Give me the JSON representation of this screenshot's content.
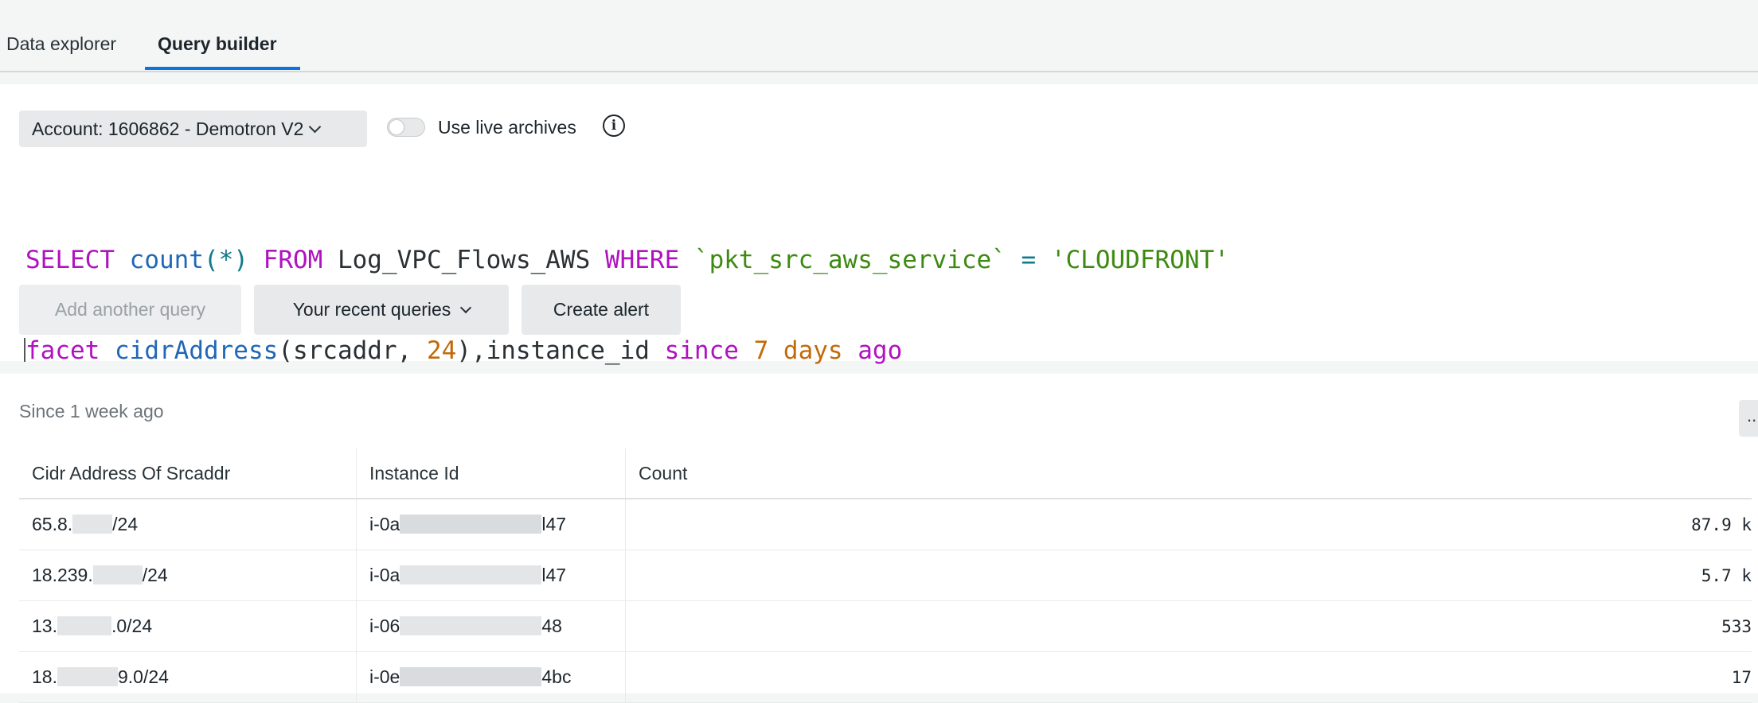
{
  "tabs": [
    {
      "label": "Data explorer",
      "active": false
    },
    {
      "label": "Query builder",
      "active": true
    }
  ],
  "query_panel": {
    "account_label": "Account: 1606862 - Demotron V2",
    "live_archives_label": "Use live archives",
    "live_archives_enabled": false,
    "query_line1": [
      {
        "t": "SELECT",
        "c": "kw"
      },
      {
        "t": " ",
        "c": "tx"
      },
      {
        "t": "count",
        "c": "fn"
      },
      {
        "t": "(*)",
        "c": "op"
      },
      {
        "t": " ",
        "c": "tx"
      },
      {
        "t": "FROM",
        "c": "kw"
      },
      {
        "t": " Log_VPC_Flows_AWS ",
        "c": "tx"
      },
      {
        "t": "WHERE",
        "c": "kw"
      },
      {
        "t": " ",
        "c": "tx"
      },
      {
        "t": "`pkt_src_aws_service`",
        "c": "str"
      },
      {
        "t": " = ",
        "c": "op"
      },
      {
        "t": "'CLOUDFRONT'",
        "c": "str"
      }
    ],
    "query_line2": [
      {
        "t": "facet",
        "c": "kw"
      },
      {
        "t": " ",
        "c": "tx"
      },
      {
        "t": "cidrAddress",
        "c": "fn"
      },
      {
        "t": "(srcaddr, ",
        "c": "tx"
      },
      {
        "t": "24",
        "c": "num"
      },
      {
        "t": "),instance_id ",
        "c": "tx"
      },
      {
        "t": "since",
        "c": "kw"
      },
      {
        "t": " ",
        "c": "tx"
      },
      {
        "t": "7",
        "c": "num"
      },
      {
        "t": " ",
        "c": "tx"
      },
      {
        "t": "days",
        "c": "num"
      },
      {
        "t": " ",
        "c": "tx"
      },
      {
        "t": "ago",
        "c": "kw"
      }
    ],
    "buttons": {
      "add_query": "Add another query",
      "recent_queries": "Your recent queries",
      "create_alert": "Create alert"
    }
  },
  "results": {
    "since_label": "Since 1 week ago",
    "more_label": "...",
    "columns": [
      "Cidr Address Of Srcaddr",
      "Instance Id",
      "Count"
    ],
    "rows": [
      {
        "cidr_pre": "65.8.",
        "cidr_post": "/24",
        "inst_pre": "i-0a",
        "inst_post": "l47",
        "count": "87.9 k"
      },
      {
        "cidr_pre": "18.239.",
        "cidr_post": "/24",
        "inst_pre": "i-0a",
        "inst_post": "l47",
        "count": "5.7 k"
      },
      {
        "cidr_pre": "13.",
        "cidr_post": ".0/24",
        "inst_pre": "i-06",
        "inst_post": "48",
        "count": "533"
      },
      {
        "cidr_pre": "18.",
        "cidr_post": "9.0/24",
        "inst_pre": "i-0e",
        "inst_post": "4bc",
        "count": "17"
      }
    ]
  }
}
